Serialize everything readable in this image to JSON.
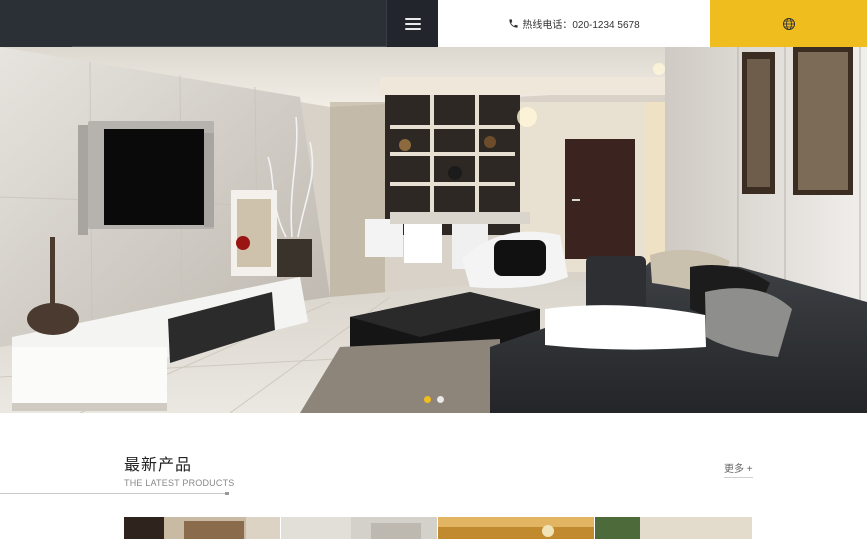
{
  "header": {
    "hotline_label": "热线电话：020-1234 5678"
  },
  "slider": {
    "slide_count": 2,
    "active_index": 0
  },
  "section": {
    "title": "最新产品",
    "subtitle": "THE LATEST PRODUCTS",
    "more_label": "更多 +"
  },
  "colors": {
    "header_bg": "#2b2f36",
    "accent_yellow": "#f0bd1f",
    "text_dark": "#222222"
  },
  "icons": {
    "menu": "hamburger-icon",
    "phone": "phone-icon",
    "language": "globe-icon"
  }
}
